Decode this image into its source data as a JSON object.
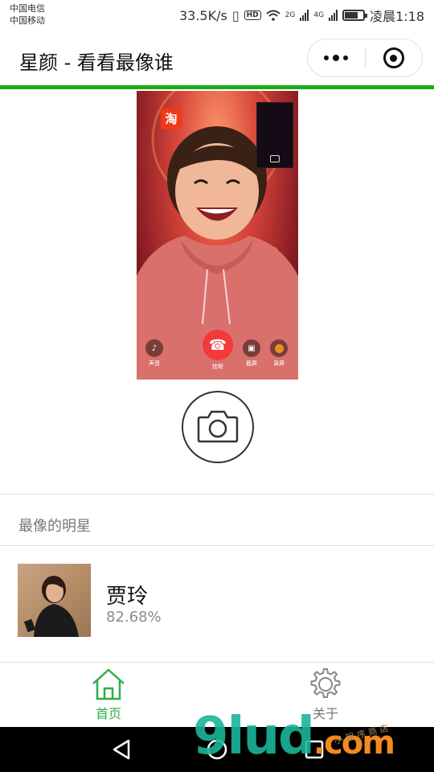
{
  "status_bar": {
    "carrier_1": "中国电信",
    "carrier_2": "中国移动",
    "speed": "33.5K/s",
    "hd": "HD",
    "net_2g": "2G",
    "net_4g": "4G",
    "time": "凌晨1:18"
  },
  "nav": {
    "title": "星颜 - 看看最像谁",
    "more_icon": "more-dots-icon",
    "close_icon": "target-circle-icon"
  },
  "photo": {
    "app_badge": "淘",
    "controls": {
      "sound": "声音",
      "hangup": "挂断",
      "screenshot": "截屏",
      "record": "录屏"
    }
  },
  "capture": {
    "icon": "camera-icon"
  },
  "results": {
    "section_title": "最像的明星",
    "items": [
      {
        "name": "贾玲",
        "score": "82.68%"
      }
    ]
  },
  "tabbar": {
    "home_label": "首页",
    "about_label": "关于",
    "home_icon": "home-icon",
    "about_icon": "gear-icon",
    "active_color": "#2eae4b"
  },
  "watermark": {
    "main": "9lud",
    "com": ".com",
    "sub": "小 程 序 商 店"
  },
  "colors": {
    "accent_green": "#1aad19",
    "hangup_red": "#f23a3a"
  }
}
